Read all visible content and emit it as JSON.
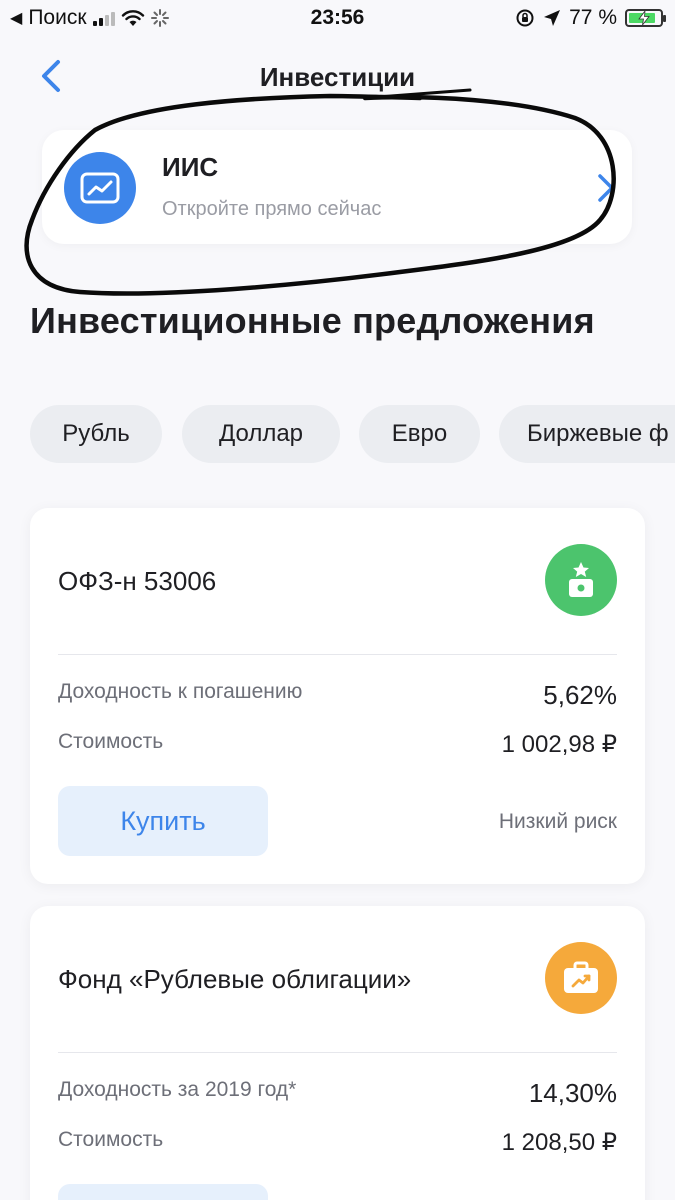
{
  "status_bar": {
    "back_app": "Поиск",
    "time": "23:56",
    "battery": "77 %"
  },
  "header": {
    "title": "Инвестиции"
  },
  "iis": {
    "title": "ИИС",
    "subtitle": "Откройте прямо сейчас"
  },
  "section": {
    "title": "Инвестиционные предложения"
  },
  "chips": [
    "Рубль",
    "Доллар",
    "Евро",
    "Биржевые ф"
  ],
  "offers": [
    {
      "name": "ОФЗ-н 53006",
      "badge_color": "#4cc46d",
      "yield_label": "Доходность к погашению",
      "yield_value": "5,62%",
      "price_label": "Стоимость",
      "price_value": "1 002,98 ₽",
      "buy_label": "Купить",
      "risk": "Низкий риск"
    },
    {
      "name": "Фонд «Рублевые облигации»",
      "badge_color": "#f5a93b",
      "yield_label": "Доходность за 2019 год*",
      "yield_value": "14,30%",
      "price_label": "Стоимость",
      "price_value": "1 208,50 ₽"
    }
  ],
  "colors": {
    "accent": "#3d85ea",
    "background": "#f8f8fb"
  }
}
